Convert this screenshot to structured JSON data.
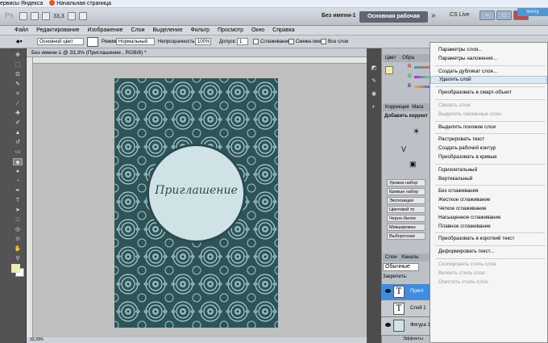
{
  "bookmarks": {
    "items": [
      "ервисы Яндекса",
      "Начальная страница"
    ]
  },
  "ps": {
    "logo": "Ps",
    "zoom": "33,3",
    "doc_name": "Без имени-1",
    "workspace": "Основная рабочая среда",
    "chevron": "»",
    "cslive": "CS Live",
    "mail_btn": "почту"
  },
  "menu": [
    "Файл",
    "Редактирование",
    "Изображение",
    "Слои",
    "Выделение",
    "Фильтр",
    "Просмотр",
    "Окно",
    "Справка"
  ],
  "options": {
    "source": "Основной цвет",
    "mode_label": "Режим:",
    "mode_value": "Нормальный",
    "opacity_label": "Непрозрачность:",
    "opacity_value": "100%",
    "tolerance_label": "Допуск:",
    "tolerance_value": "1",
    "antialias": "Сглаживание",
    "contiguous": "Смежн.пикс",
    "all_layers": "Все слои"
  },
  "doc_tab": "Без имени-1 @ 33,3% (Приглашение , RGB/8) *",
  "artwork": {
    "title": "Приглашение",
    "bg_color": "#2f5458",
    "circle_color": "#cfe3e6"
  },
  "panels": {
    "color_tab": "Цвет",
    "swatches_tab": "Обра",
    "channels": [
      "R",
      "G",
      "B"
    ],
    "correction_tab": "Коррекция",
    "mask_tab": "Маск",
    "add_correction": "Добавить коррект",
    "presets": [
      "Уровни набор",
      "Кривые набор",
      "Экспозиция",
      "Цветовой то",
      "Черно-белое",
      "Микширован",
      "Выборочная"
    ],
    "layers_tab": "Слои",
    "channels_tab": "Каналы",
    "blend_mode": "Обычные",
    "lock_label": "Закрепить:"
  },
  "layers": [
    {
      "name": "Пригл",
      "type": "T",
      "selected": true
    },
    {
      "name": "Слой 1",
      "type": "T",
      "selected": false
    },
    {
      "name": "Фигура 1",
      "type": "shape",
      "selected": false
    }
  ],
  "layer_effects": "Эффекты",
  "context_menu": {
    "items": [
      {
        "label": "Параметры слоя...",
        "state": "normal"
      },
      {
        "label": "Параметры наложения...",
        "state": "normal"
      },
      {
        "sep": true
      },
      {
        "label": "Создать дубликат слоя...",
        "state": "normal"
      },
      {
        "label": "Удалить слой",
        "state": "highlight"
      },
      {
        "sep": true
      },
      {
        "label": "Преобразовать в смарт-объект",
        "state": "normal"
      },
      {
        "sep": true
      },
      {
        "label": "Связать слои",
        "state": "disabled"
      },
      {
        "label": "Выделить связанные слои",
        "state": "disabled"
      },
      {
        "sep": true
      },
      {
        "label": "Выделить похожие слои",
        "state": "normal"
      },
      {
        "sep": true
      },
      {
        "label": "Растрировать текст",
        "state": "normal"
      },
      {
        "label": "Создать рабочий контур",
        "state": "normal"
      },
      {
        "label": "Преобразовать в кривые",
        "state": "normal"
      },
      {
        "sep": true
      },
      {
        "label": "Горизонтальный",
        "state": "normal"
      },
      {
        "label": "Вертикальный",
        "state": "normal"
      },
      {
        "sep": true
      },
      {
        "label": "Без сглаживания",
        "state": "normal"
      },
      {
        "label": "Жесткое сглаживание",
        "state": "normal"
      },
      {
        "label": "Четкое сглаживание",
        "state": "normal"
      },
      {
        "label": "Насыщенное сглаживание",
        "state": "normal"
      },
      {
        "label": "Плавное сглаживание",
        "state": "normal"
      },
      {
        "sep": true
      },
      {
        "label": "Преобразовать в короткий текст",
        "state": "normal"
      },
      {
        "sep": true
      },
      {
        "label": "Деформировать текст...",
        "state": "normal"
      },
      {
        "sep": true
      },
      {
        "label": "Скопировать стиль слоя",
        "state": "disabled"
      },
      {
        "label": "Вклеить стиль слоя",
        "state": "disabled"
      },
      {
        "label": "Очистить стиль слоя",
        "state": "disabled"
      }
    ]
  },
  "status": "33,33%",
  "colors": {
    "accent": "#3d8de4",
    "highlight": "#dde7f4",
    "swatch_fg": "#f3ef9f"
  }
}
